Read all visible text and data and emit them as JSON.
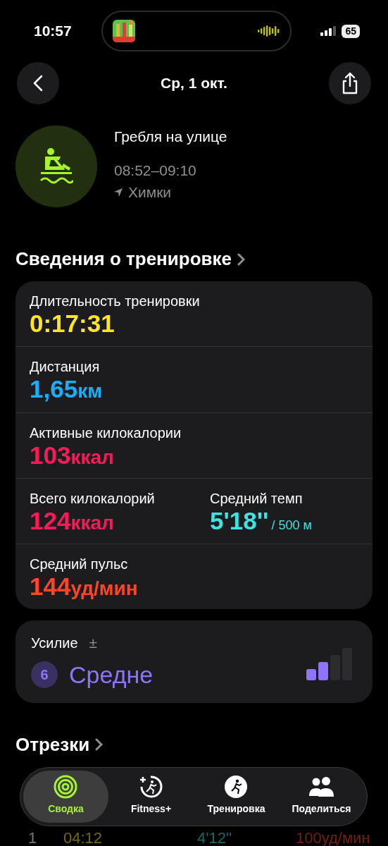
{
  "status_bar": {
    "time": "10:57",
    "battery": "65"
  },
  "nav": {
    "title": "Ср, 1 окт."
  },
  "workout": {
    "name": "Гребля на улице",
    "time_range": "08:52–09:10",
    "location": "Химки"
  },
  "details": {
    "title": "Сведения о тренировке",
    "rows": [
      [
        {
          "label": "Длительность тренировки",
          "value": "0:17:31",
          "color": "#ffe620"
        }
      ],
      [
        {
          "label": "Дистанция",
          "value": "1,65",
          "unit": "км",
          "color": "#1badf8"
        }
      ],
      [
        {
          "label": "Активные килокалории",
          "value": "103",
          "unit": "ккал",
          "color": "#fa1a5a"
        }
      ],
      [
        {
          "label": "Всего килокалорий",
          "value": "124",
          "unit": "ккал",
          "color": "#fa1a5a"
        },
        {
          "label": "Средний темп",
          "value": "5'18''",
          "suffix": "/ 500 м",
          "color": "#3fe3e1"
        }
      ],
      [
        {
          "label": "Средний пульс",
          "value": "144",
          "unit": "уд/мин",
          "color": "#fe4526"
        }
      ]
    ]
  },
  "effort": {
    "label": "Усилие",
    "adjust": "±",
    "number": "6",
    "text": "Средне",
    "level": 0.5
  },
  "splits": {
    "title": "Отрезки",
    "row": [
      "1",
      "04:12",
      "4'12''",
      "100уд/мин"
    ]
  },
  "tabs": [
    {
      "label": "Сводка",
      "selected": true
    },
    {
      "label": "Fitness+",
      "selected": false
    },
    {
      "label": "Тренировка",
      "selected": false
    },
    {
      "label": "Поделиться",
      "selected": false
    }
  ]
}
